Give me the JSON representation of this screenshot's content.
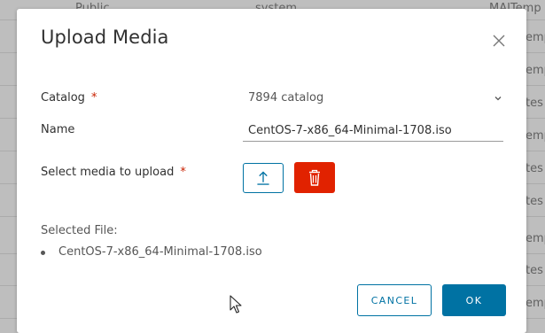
{
  "background_table": {
    "top_row": {
      "col1": "Public",
      "col2": "system",
      "col3": "MAITemp"
    },
    "side_fragments": [
      "emp",
      "emp",
      "tes",
      "emp",
      "tes",
      "tes",
      "emp",
      "tes",
      "emp"
    ]
  },
  "dialog": {
    "title": "Upload Media",
    "close_icon": "close-icon",
    "catalog": {
      "label": "Catalog",
      "required_mark": "*",
      "selected_value": "7894 catalog"
    },
    "name": {
      "label": "Name",
      "value": "CentOS-7-x86_64-Minimal-1708.iso"
    },
    "media": {
      "label": "Select media to upload",
      "required_mark": "*",
      "upload_icon": "upload-icon",
      "delete_icon": "trash-icon"
    },
    "selected_file": {
      "label": "Selected File:",
      "files": [
        "CentOS-7-x86_64-Minimal-1708.iso"
      ]
    },
    "buttons": {
      "cancel": "CANCEL",
      "ok": "OK"
    }
  },
  "colors": {
    "primary": "#0072a3",
    "danger": "#e12200",
    "required": "#c92100"
  }
}
